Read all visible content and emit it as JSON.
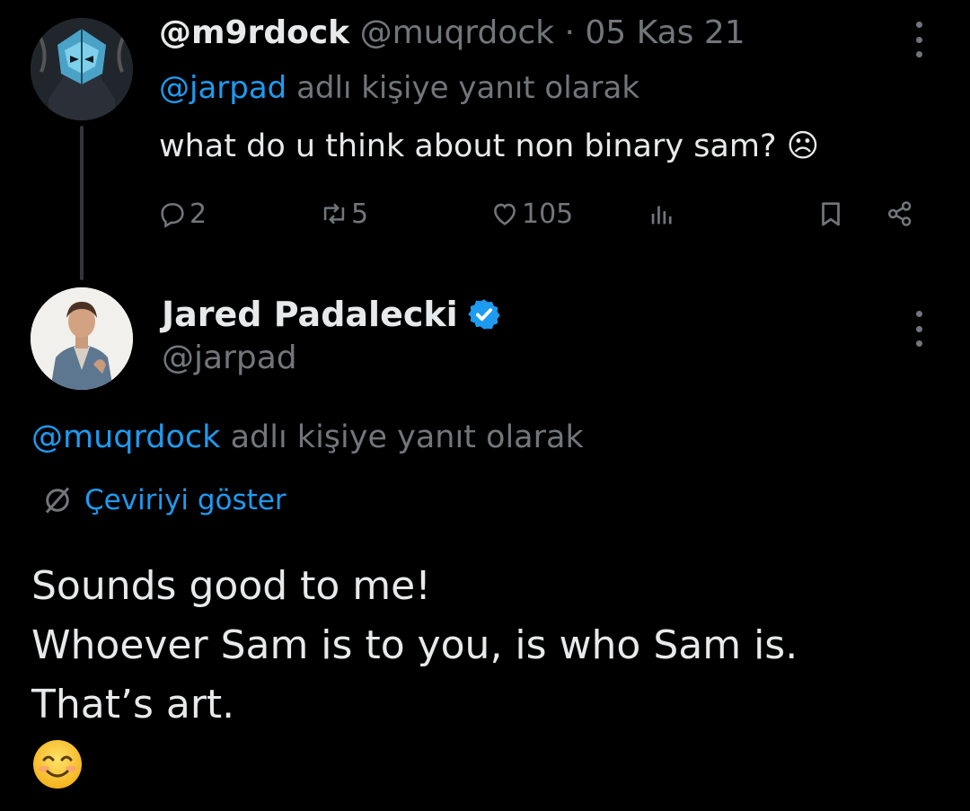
{
  "tweet1": {
    "display_name": "@m9rdock",
    "handle": "@muqrdock",
    "separator": "·",
    "date": "05 Kas 21",
    "reply_to_handle": "@jarpad",
    "reply_suffix": "adlı kişiye yanıt olarak",
    "text": "what do u think about non binary sam? ☹",
    "stats": {
      "replies": "2",
      "retweets": "5",
      "likes": "105"
    }
  },
  "tweet2": {
    "display_name": "Jared Padalecki",
    "handle": "@jarpad",
    "reply_to_handle": "@muqrdock",
    "reply_suffix": "adlı kişiye yanıt olarak",
    "translate_label": "Çeviriyi göster",
    "text_lines": [
      "Sounds good to me!",
      "Whoever Sam is to you, is who Sam is.",
      "That’s art."
    ]
  },
  "colors": {
    "background": "#000000",
    "text": "#e7e9ea",
    "muted": "#71767b",
    "link": "#1d9bf0",
    "verified": "#1d9bf0"
  },
  "icons": [
    "reply-icon",
    "retweet-icon",
    "like-icon",
    "views-icon",
    "bookmark-icon",
    "share-icon",
    "more-icon",
    "verified-badge-icon",
    "translate-icon",
    "smiling-face-emoji"
  ]
}
